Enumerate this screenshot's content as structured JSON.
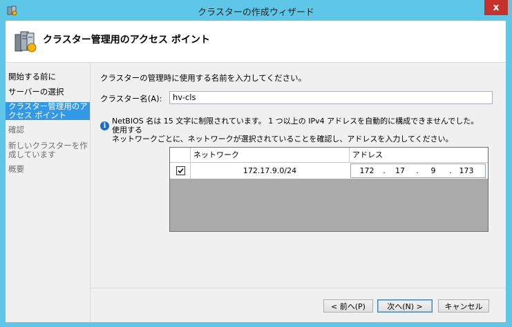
{
  "window": {
    "title": "クラスターの作成ウィザード",
    "close_label": "x"
  },
  "header": {
    "title": "クラスター管理用のアクセス ポイント"
  },
  "sidebar": {
    "items": [
      {
        "label": "開始する前に",
        "state": "normal"
      },
      {
        "label": "サーバーの選択",
        "state": "normal"
      },
      {
        "label": "クラスター管理用のアクセス ポイント",
        "state": "active"
      },
      {
        "label": "確認",
        "state": "disabled"
      },
      {
        "label": "新しいクラスターを作成しています",
        "state": "disabled"
      },
      {
        "label": "概要",
        "state": "disabled"
      }
    ]
  },
  "main": {
    "instruction": "クラスターの管理時に使用する名前を入力してください。",
    "cluster_name_label": "クラスター名(A):",
    "cluster_name_value": "hv-cls",
    "info_line1": "NetBIOS 名は 15 文字に制限されています。 1 つ以上の IPv4 アドレスを自動的に構成できませんでした。使用する",
    "info_line2": "ネットワークごとに、ネットワークが選択されていることを確認し、アドレスを入力してください。"
  },
  "grid": {
    "headers": {
      "network": "ネットワーク",
      "address": "アドレス"
    },
    "rows": [
      {
        "checked": true,
        "network": "172.17.9.0/24",
        "octets": [
          "172",
          "17",
          "9",
          "173"
        ]
      }
    ]
  },
  "footer": {
    "back": "< 前へ(P)",
    "next": "次へ(N) >",
    "cancel": "キャンセル"
  },
  "colors": {
    "frame": "#5ec7e8",
    "close": "#c7312b",
    "selection": "#3399e6"
  },
  "icons": {
    "app": "cluster-app-icon",
    "header": "server-cluster-icon",
    "info": "info-icon",
    "check": "checkmark-icon"
  }
}
